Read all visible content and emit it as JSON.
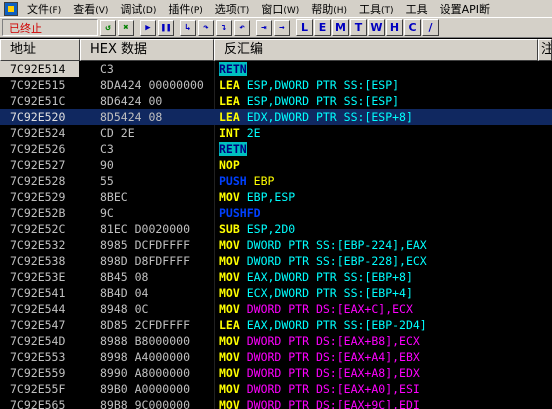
{
  "menu": [
    {
      "label": "文件",
      "acc": "(F)"
    },
    {
      "label": "查看",
      "acc": "(V)"
    },
    {
      "label": "调试",
      "acc": "(D)"
    },
    {
      "label": "插件",
      "acc": "(P)"
    },
    {
      "label": "选项",
      "acc": "(T)"
    },
    {
      "label": "窗口",
      "acc": "(W)"
    },
    {
      "label": "帮助",
      "acc": "(H)"
    },
    {
      "label": "工具",
      "acc": "(T)"
    },
    {
      "label": "工具",
      "acc": ""
    },
    {
      "label": "设置API断",
      "acc": ""
    }
  ],
  "toolbar": {
    "status": "已终止",
    "letter_buttons": [
      "L",
      "E",
      "M",
      "T",
      "W",
      "H",
      "C",
      "/"
    ]
  },
  "headers": [
    "地址",
    "HEX 数据",
    "反汇编",
    "注"
  ],
  "colors": {
    "mnemonic_default": "#ffff00",
    "register": "#00ffff",
    "memory_operand": "#ff00ff",
    "stack_ops": "#0040ff",
    "string_ops": "#ff00ff",
    "highlight_bg": "#00c0c0"
  },
  "rows": [
    {
      "addr": "7C92E514",
      "hex": "C3",
      "mn": "RETN",
      "ops": "",
      "style": "retn-hl",
      "cur": true
    },
    {
      "addr": "7C92E515",
      "hex": "8DA424 00000000",
      "mn": "LEA",
      "ops": "ESP,DWORD PTR SS:[ESP]",
      "style": "lea-reg"
    },
    {
      "addr": "7C92E51C",
      "hex": "8D6424 00",
      "mn": "LEA",
      "ops": "ESP,DWORD PTR SS:[ESP]",
      "style": "lea-reg"
    },
    {
      "addr": "7C92E520",
      "hex": "8D5424 08",
      "mn": "LEA",
      "ops": "EDX,DWORD PTR SS:[ESP+8]",
      "style": "lea-reg",
      "sel": true
    },
    {
      "addr": "7C92E524",
      "hex": "CD 2E",
      "mn": "INT",
      "ops": "2E",
      "style": "int"
    },
    {
      "addr": "7C92E526",
      "hex": "C3",
      "mn": "RETN",
      "ops": "",
      "style": "retn-hl"
    },
    {
      "addr": "7C92E527",
      "hex": "90",
      "mn": "NOP",
      "ops": "",
      "style": "plain"
    },
    {
      "addr": "7C92E528",
      "hex": "55",
      "mn": "PUSH",
      "ops": "EBP",
      "style": "push"
    },
    {
      "addr": "7C92E529",
      "hex": "8BEC",
      "mn": "MOV",
      "ops": "EBP,ESP",
      "style": "reg"
    },
    {
      "addr": "7C92E52B",
      "hex": "9C",
      "mn": "PUSHFD",
      "ops": "",
      "style": "push"
    },
    {
      "addr": "7C92E52C",
      "hex": "81EC D0020000",
      "mn": "SUB",
      "ops": "ESP,2D0",
      "style": "sub"
    },
    {
      "addr": "7C92E532",
      "hex": "8985 DCFDFFFF",
      "mn": "MOV",
      "ops": "DWORD PTR SS:[EBP-224],EAX",
      "style": "reg"
    },
    {
      "addr": "7C92E538",
      "hex": "898D D8FDFFFF",
      "mn": "MOV",
      "ops": "DWORD PTR SS:[EBP-228],ECX",
      "style": "reg"
    },
    {
      "addr": "7C92E53E",
      "hex": "8B45 08",
      "mn": "MOV",
      "ops": "EAX,DWORD PTR SS:[EBP+8]",
      "style": "reg"
    },
    {
      "addr": "7C92E541",
      "hex": "8B4D 04",
      "mn": "MOV",
      "ops": "ECX,DWORD PTR SS:[EBP+4]",
      "style": "reg"
    },
    {
      "addr": "7C92E544",
      "hex": "8948 0C",
      "mn": "MOV",
      "ops": "DWORD PTR DS:[EAX+C],ECX",
      "style": "mem"
    },
    {
      "addr": "7C92E547",
      "hex": "8D85 2CFDFFFF",
      "mn": "LEA",
      "ops": "EAX,DWORD PTR SS:[EBP-2D4]",
      "style": "lea-reg"
    },
    {
      "addr": "7C92E54D",
      "hex": "8988 B8000000",
      "mn": "MOV",
      "ops": "DWORD PTR DS:[EAX+B8],ECX",
      "style": "mem"
    },
    {
      "addr": "7C92E553",
      "hex": "8998 A4000000",
      "mn": "MOV",
      "ops": "DWORD PTR DS:[EAX+A4],EBX",
      "style": "mem"
    },
    {
      "addr": "7C92E559",
      "hex": "8990 A8000000",
      "mn": "MOV",
      "ops": "DWORD PTR DS:[EAX+A8],EDX",
      "style": "mem"
    },
    {
      "addr": "7C92E55F",
      "hex": "89B0 A0000000",
      "mn": "MOV",
      "ops": "DWORD PTR DS:[EAX+A0],ESI",
      "style": "mem"
    },
    {
      "addr": "7C92E565",
      "hex": "89B8 9C000000",
      "mn": "MOV",
      "ops": "DWORD PTR DS:[EAX+9C],EDI",
      "style": "mem"
    }
  ]
}
